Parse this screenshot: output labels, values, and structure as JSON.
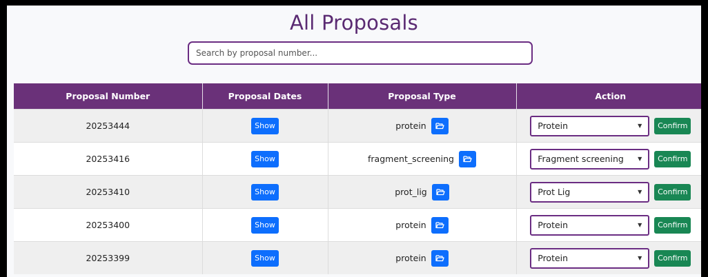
{
  "page": {
    "title": "All Proposals",
    "search_placeholder": "Search by proposal number..."
  },
  "table": {
    "headers": [
      "Proposal Number",
      "Proposal Dates",
      "Proposal Type",
      "Action"
    ],
    "show_label": "Show",
    "confirm_label": "Confirm",
    "rows": [
      {
        "number": "20253444",
        "type": "protein",
        "selected": "Protein"
      },
      {
        "number": "20253416",
        "type": "fragment_screening",
        "selected": "Fragment screening"
      },
      {
        "number": "20253410",
        "type": "prot_lig",
        "selected": "Prot Lig"
      },
      {
        "number": "20253400",
        "type": "protein",
        "selected": "Protein"
      },
      {
        "number": "20253399",
        "type": "protein",
        "selected": "Protein"
      }
    ]
  },
  "icons": {
    "folder": "folder-open-icon",
    "dropdown": "caret-down-icon"
  },
  "colors": {
    "accent": "#6a3179",
    "primary_button": "#0d6efd",
    "confirm_button": "#198754"
  }
}
